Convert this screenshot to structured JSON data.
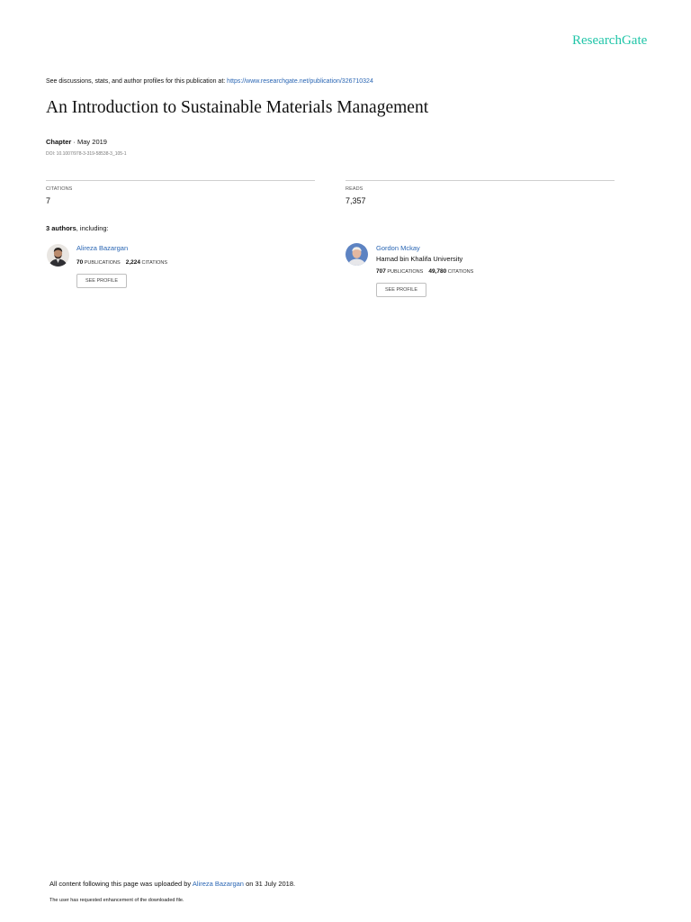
{
  "header": {
    "logo_text": "ResearchGate",
    "discussions_text": "See discussions, stats, and author profiles for this publication at: ",
    "publication_url": "https://www.researchgate.net/publication/326710324"
  },
  "publication": {
    "title": "An Introduction to Sustainable Materials Management",
    "type": "Chapter",
    "separator": " · ",
    "date": "May 2019",
    "doi": "DOI: 10.1007/978-3-319-58538-3_105-1"
  },
  "stats": {
    "citations_label": "CITATIONS",
    "citations_value": "7",
    "reads_label": "READS",
    "reads_value": "7,357"
  },
  "authors": {
    "count_text": "3 authors",
    "including_text": ", including:",
    "list": [
      {
        "name": "Alireza Bazargan",
        "institution": "",
        "publications_count": "70",
        "publications_label": "PUBLICATIONS",
        "citations_count": "2,224",
        "citations_label": "CITATIONS",
        "button_label": "SEE PROFILE"
      },
      {
        "name": "Gordon Mckay",
        "institution": "Hamad bin Khalifa University",
        "publications_count": "707",
        "publications_label": "PUBLICATIONS",
        "citations_count": "49,780",
        "citations_label": "CITATIONS",
        "button_label": "SEE PROFILE"
      }
    ]
  },
  "footer": {
    "uploaded_prefix": "All content following this page was uploaded by ",
    "uploader_name": "Alireza Bazargan",
    "uploaded_suffix": " on 31 July 2018.",
    "request_text": "The user has requested enhancement of the downloaded file."
  },
  "colors": {
    "brand": "#20c5a8",
    "link": "#2a66b4",
    "divider": "#cfcfcf"
  }
}
